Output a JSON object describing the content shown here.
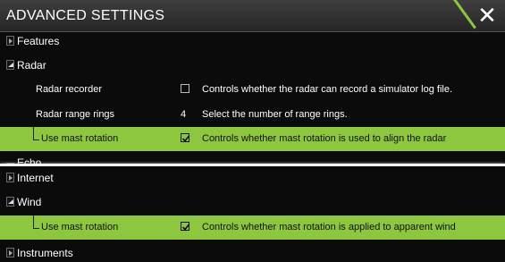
{
  "title": "ADVANCED SETTINGS",
  "close_icon": "close-icon",
  "groups_top": {
    "features": {
      "label": "Features",
      "expanded": false
    },
    "radar": {
      "label": "Radar",
      "expanded": true,
      "recorder": {
        "label": "Radar recorder",
        "checked": false,
        "description": "Controls whether the radar can record a simulator log file."
      },
      "range_rings": {
        "label": "Radar range rings",
        "value": "4",
        "description": "Select the number of range rings."
      },
      "mast": {
        "label": "Use mast rotation",
        "checked": true,
        "description": "Controls whether mast rotation is used to align the radar"
      }
    },
    "partial": {
      "label": "Echo"
    }
  },
  "groups_bottom": {
    "internet": {
      "label": "Internet",
      "expanded": false
    },
    "wind": {
      "label": "Wind",
      "expanded": true,
      "mast": {
        "label": "Use mast rotation",
        "checked": true,
        "description": "Controls whether mast rotation is applied to apparent wind"
      }
    },
    "instruments": {
      "label": "Instruments",
      "expanded": false
    }
  },
  "colors": {
    "accent": "#8dc63f",
    "background": "#0b0b0b",
    "titlebar": "#333333"
  }
}
